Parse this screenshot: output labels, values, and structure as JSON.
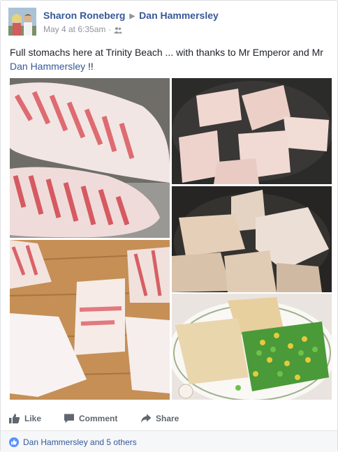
{
  "post": {
    "author": "Sharon Roneberg",
    "recipient": "Dan Hammersley",
    "timestamp": "May 4 at 6:35am",
    "audience_icon": "friends-icon",
    "text_before_mention": "Full stomachs here at Trinity Beach ... with thanks to Mr Emperor and Mr",
    "text_mention": "Dan Hammersley",
    "text_after_mention": " !!"
  },
  "actions": {
    "like_label": "Like",
    "comment_label": "Comment",
    "share_label": "Share"
  },
  "reactions": {
    "summary": "Dan Hammersley and 5 others",
    "icon": "like-badge-icon"
  },
  "colors": {
    "link": "#365899",
    "meta": "#90949c",
    "action": "#606770",
    "like_badge": "#5890ff"
  }
}
